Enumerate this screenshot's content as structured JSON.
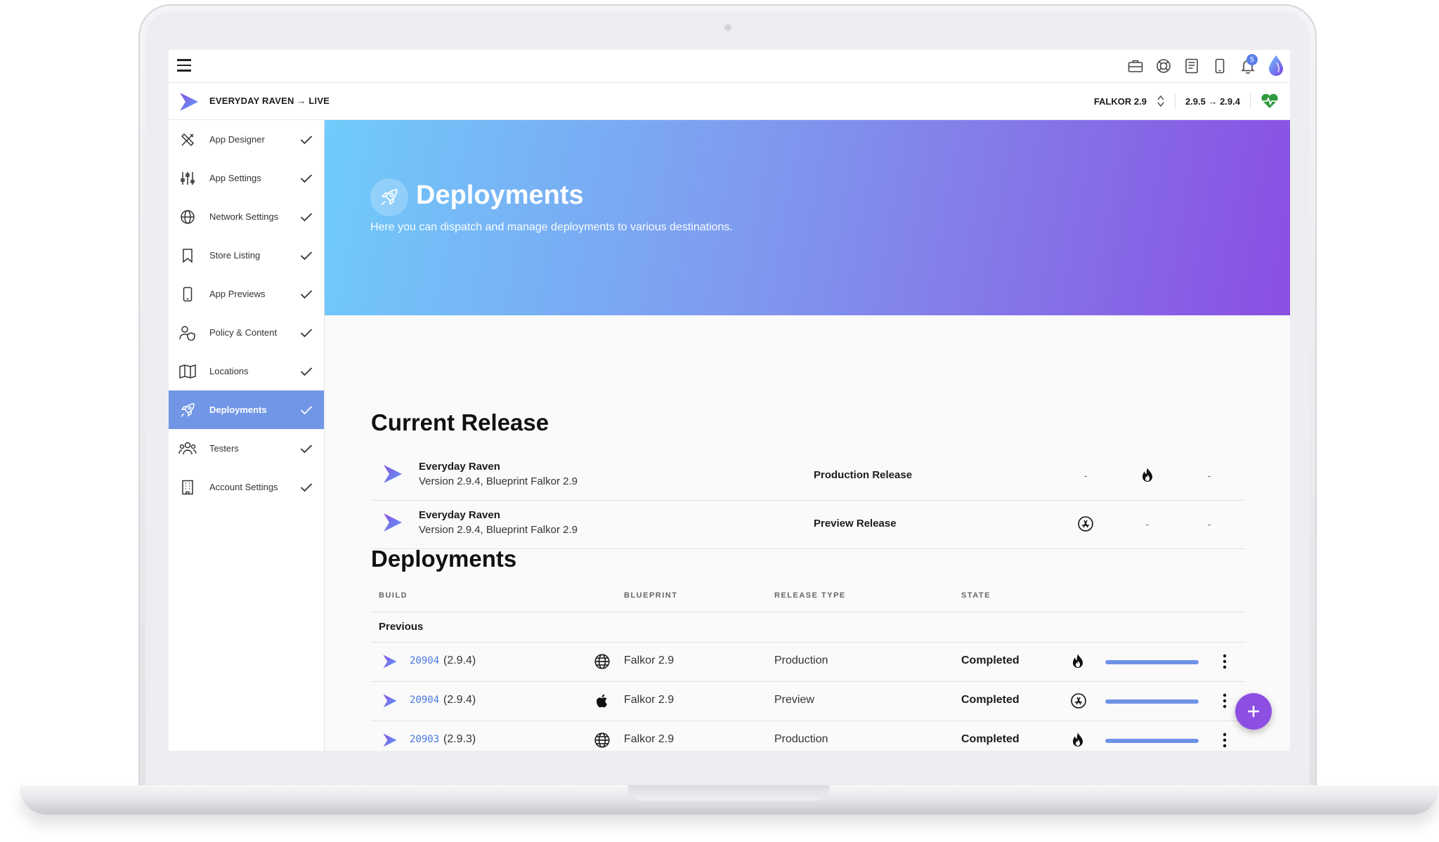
{
  "topbar": {
    "icons": [
      "briefcase-icon",
      "lifebuoy-icon",
      "book-icon",
      "phone-icon",
      "bell-icon",
      "droplet-logo"
    ],
    "notification_count": "5"
  },
  "app": {
    "name": "EVERYDAY RAVEN → LIVE",
    "blueprint": "FALKOR 2.9",
    "version_change": "2.9.5 → 2.9.4",
    "health_icon": "heartbeat-icon",
    "health_color": "#2e9a3e"
  },
  "sidebar": {
    "items": [
      {
        "label": "App Designer",
        "icon": "designer-tools-icon"
      },
      {
        "label": "App Settings",
        "icon": "sliders-icon"
      },
      {
        "label": "Network Settings",
        "icon": "globe-icon"
      },
      {
        "label": "Store Listing",
        "icon": "bookmark-icon"
      },
      {
        "label": "App Previews",
        "icon": "phone-icon"
      },
      {
        "label": "Policy & Content",
        "icon": "user-shield-icon"
      },
      {
        "label": "Locations",
        "icon": "map-icon"
      },
      {
        "label": "Deployments",
        "icon": "rocket-icon",
        "active": true
      },
      {
        "label": "Testers",
        "icon": "users-icon"
      },
      {
        "label": "Account Settings",
        "icon": "building-icon"
      }
    ]
  },
  "hero": {
    "title": "Deployments",
    "subtitle": "Here you can dispatch and manage deployments to various destinations.",
    "gradient_start": "#70cbfb",
    "gradient_end": "#8a4fe3"
  },
  "current_release": {
    "heading": "Current Release",
    "rows": [
      {
        "name": "Everyday Raven",
        "version": "Version 2.9.4, Blueprint Falkor 2.9",
        "type": "Production Release",
        "col1": "-",
        "col2_icon": "flame-icon",
        "col3": "-"
      },
      {
        "name": "Everyday Raven",
        "version": "Version 2.9.4, Blueprint Falkor 2.9",
        "type": "Preview Release",
        "col1_icon": "app-store-icon",
        "col2": "-",
        "col3": "-"
      }
    ]
  },
  "deployments": {
    "heading": "Deployments",
    "columns": {
      "build": "BUILD",
      "blueprint": "BLUEPRINT",
      "release_type": "RELEASE TYPE",
      "state": "STATE"
    },
    "group_label": "Previous",
    "rows": [
      {
        "build": "20904",
        "version": "(2.9.4)",
        "platform_icon": "globe-icon",
        "blueprint": "Falkor 2.9",
        "release_type": "Production",
        "state": "Completed",
        "state_icon": "flame-icon",
        "progress": 1.0
      },
      {
        "build": "20904",
        "version": "(2.9.4)",
        "platform_icon": "apple-icon",
        "blueprint": "Falkor 2.9",
        "release_type": "Preview",
        "state": "Completed",
        "state_icon": "app-store-icon",
        "progress": 1.0
      },
      {
        "build": "20903",
        "version": "(2.9.3)",
        "platform_icon": "globe-icon",
        "blueprint": "Falkor 2.9",
        "release_type": "Production",
        "state": "Completed",
        "state_icon": "flame-icon",
        "progress": 1.0
      }
    ]
  },
  "fab": {
    "icon": "plus-icon",
    "color": "#8d4ee2"
  }
}
